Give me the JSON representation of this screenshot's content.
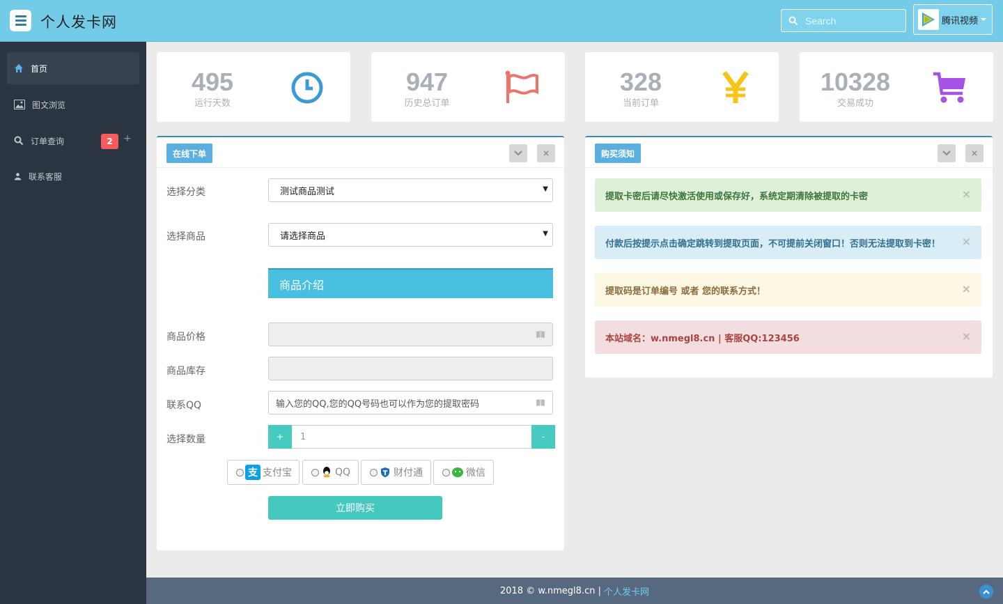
{
  "header": {
    "brand": "个人发卡网",
    "search_placeholder": "Search",
    "user_name": "腾讯视频",
    "avatar_caption": "腾讯视频"
  },
  "sidebar": {
    "items": [
      {
        "label": "首页",
        "icon": "home-icon"
      },
      {
        "label": "图文浏览",
        "icon": "image-icon"
      },
      {
        "label": "订单查询",
        "icon": "search-icon",
        "badge": "2",
        "extra": "+"
      },
      {
        "label": "联系客服",
        "icon": "user-icon"
      }
    ]
  },
  "stats": [
    {
      "value": "495",
      "label": "运行天数",
      "icon": "clock-icon",
      "color": "#3c9bd6"
    },
    {
      "value": "947",
      "label": "历史总订单",
      "icon": "flag-icon",
      "color": "#f0736a"
    },
    {
      "value": "328",
      "label": "当前订单",
      "icon": "yen-icon",
      "color": "#f5c619"
    },
    {
      "value": "10328",
      "label": "交易成功",
      "icon": "cart-icon",
      "color": "#a552e6"
    }
  ],
  "order_panel": {
    "tag": "在线下单",
    "collapse": "⌄",
    "close": "×",
    "category_label": "选择分类",
    "category_value": "测试商品测试",
    "product_label": "选择商品",
    "product_value": "请选择商品",
    "select_arrow": "▼",
    "intro": "商品介绍",
    "price_label": "商品价格",
    "stock_label": "商品库存",
    "qq_label": "联系QQ",
    "qq_placeholder": "输入您的QQ,您的QQ号码也可以作为您的提取密码",
    "qty_label": "选择数量",
    "qty_plus": "+",
    "qty_minus": "-",
    "qty_value": "1",
    "payments": [
      {
        "label": "支付宝",
        "icon": "alipay-icon"
      },
      {
        "label": "QQ",
        "icon": "qq-icon"
      },
      {
        "label": "财付通",
        "icon": "tenpay-icon"
      },
      {
        "label": "微信",
        "icon": "wechat-icon"
      }
    ],
    "buy_label": "立即购买"
  },
  "notice_panel": {
    "tag": "购买须知",
    "collapse": "⌄",
    "close": "×",
    "notices": [
      {
        "text": "提取卡密后请尽快激活使用或保存好，系统定期清除被提取的卡密",
        "type": "success"
      },
      {
        "text": "付款后按提示点击确定跳转到提取页面，不可提前关闭窗口！否则无法提取到卡密！",
        "type": "info"
      },
      {
        "text": "提取码是订单编号 或者 您的联系方式！",
        "type": "warning"
      },
      {
        "text": "本站域名：w.nmegl8.cn | 客服QQ:123456",
        "type": "danger"
      }
    ],
    "dismiss": "×"
  },
  "footer": {
    "text": "2018 © w.nmegl8.cn |",
    "link": "个人发卡网"
  },
  "colors": {
    "header": "#72cce7",
    "sidebar": "#2a3541",
    "accent": "#45c9bf",
    "badge": "#f65c5c"
  }
}
